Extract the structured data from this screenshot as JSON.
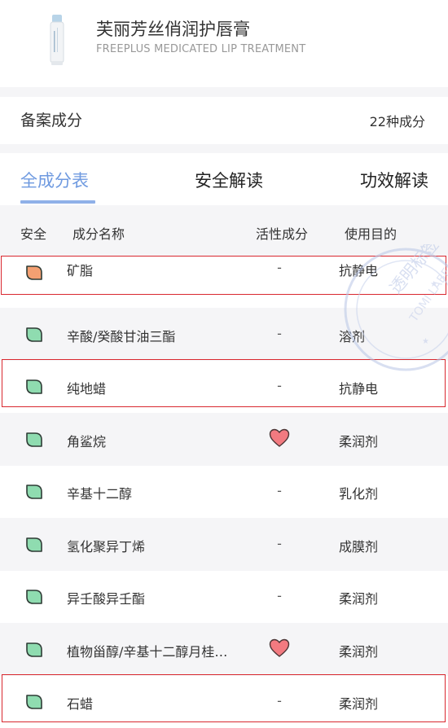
{
  "product": {
    "name": "芙丽芳丝俏润护唇膏",
    "english_name": "FREEPLUS MEDICATED LIP TREATMENT",
    "thumbnail_icon": "lip-balm-tube-icon"
  },
  "registration": {
    "label": "备案成分",
    "count": "22种成分"
  },
  "tabs": [
    {
      "label": "全成分表",
      "active": true
    },
    {
      "label": "安全解读",
      "active": false
    },
    {
      "label": "功效解读",
      "active": false
    }
  ],
  "table": {
    "headers": [
      "安全",
      "成分名称",
      "活性成分",
      "使用目的"
    ],
    "rows": [
      {
        "safety": "orange",
        "name": "矿脂",
        "active": "-",
        "purpose": "抗静电",
        "highlighted": true
      },
      {
        "safety": "green",
        "name": "辛酸/癸酸甘油三酯",
        "active": "-",
        "purpose": "溶剂",
        "highlighted": false
      },
      {
        "safety": "green",
        "name": "纯地蜡",
        "active": "-",
        "purpose": "抗静电",
        "highlighted": true
      },
      {
        "safety": "green",
        "name": "角鲨烷",
        "active": "heart",
        "purpose": "柔润剂",
        "highlighted": false
      },
      {
        "safety": "green",
        "name": "辛基十二醇",
        "active": "-",
        "purpose": "乳化剂",
        "highlighted": false
      },
      {
        "safety": "green",
        "name": "氢化聚异丁烯",
        "active": "-",
        "purpose": "成膜剂",
        "highlighted": false
      },
      {
        "safety": "green",
        "name": "异壬酸异壬酯",
        "active": "-",
        "purpose": "柔润剂",
        "highlighted": false
      },
      {
        "safety": "green",
        "name": "植物甾醇/辛基十二醇月桂…",
        "active": "heart",
        "purpose": "柔润剂",
        "highlighted": false
      },
      {
        "safety": "green",
        "name": "石蜡",
        "active": "-",
        "purpose": "柔润剂",
        "highlighted": true
      }
    ]
  },
  "colors": {
    "accent": "#6f9ae0",
    "leaf_green": "#8fdcb0",
    "leaf_orange": "#f4a072",
    "heart": "#f27a80",
    "highlight_border": "#d9282f"
  },
  "watermark": {
    "text_cn": "透明标签",
    "text_en": "TOMI LABEL"
  }
}
